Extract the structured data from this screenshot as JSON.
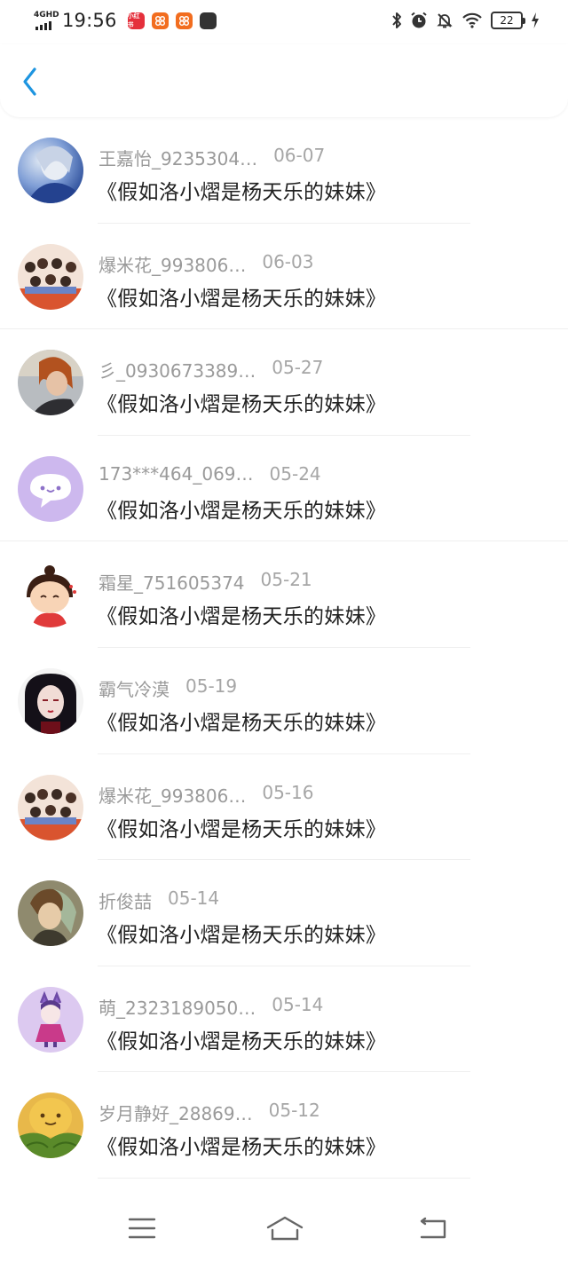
{
  "status_bar": {
    "network": "4GHD",
    "time": "19:56",
    "notif_app_label": "小红书",
    "battery": "22"
  },
  "header": {
    "back_icon": "chevron-left-icon",
    "accent_color": "#1e95e0"
  },
  "list": [
    {
      "name": "王嘉怡_9235304…",
      "date": "06-07",
      "title": "《假如洛小熠是杨天乐的妹妹》"
    },
    {
      "name": "爆米花_993806…",
      "date": "06-03",
      "title": "《假如洛小熠是杨天乐的妹妹》"
    },
    {
      "name": "彡_0930673389…",
      "date": "05-27",
      "title": "《假如洛小熠是杨天乐的妹妹》"
    },
    {
      "name": "173***464_069…",
      "date": "05-24",
      "title": "《假如洛小熠是杨天乐的妹妹》"
    },
    {
      "name": "霜星_751605374",
      "date": "05-21",
      "title": "《假如洛小熠是杨天乐的妹妹》"
    },
    {
      "name": "霸气冷漠",
      "date": "05-19",
      "title": "《假如洛小熠是杨天乐的妹妹》"
    },
    {
      "name": "爆米花_993806…",
      "date": "05-16",
      "title": "《假如洛小熠是杨天乐的妹妹》"
    },
    {
      "name": "折俊喆",
      "date": "05-14",
      "title": "《假如洛小熠是杨天乐的妹妹》"
    },
    {
      "name": "萌_2323189050…",
      "date": "05-14",
      "title": "《假如洛小熠是杨天乐的妹妹》"
    },
    {
      "name": "岁月静好_28869…",
      "date": "05-12",
      "title": "《假如洛小熠是杨天乐的妹妹》"
    }
  ],
  "navbar": {
    "menu_icon": "menu-icon",
    "home_icon": "home-icon",
    "back_icon": "back-icon"
  }
}
